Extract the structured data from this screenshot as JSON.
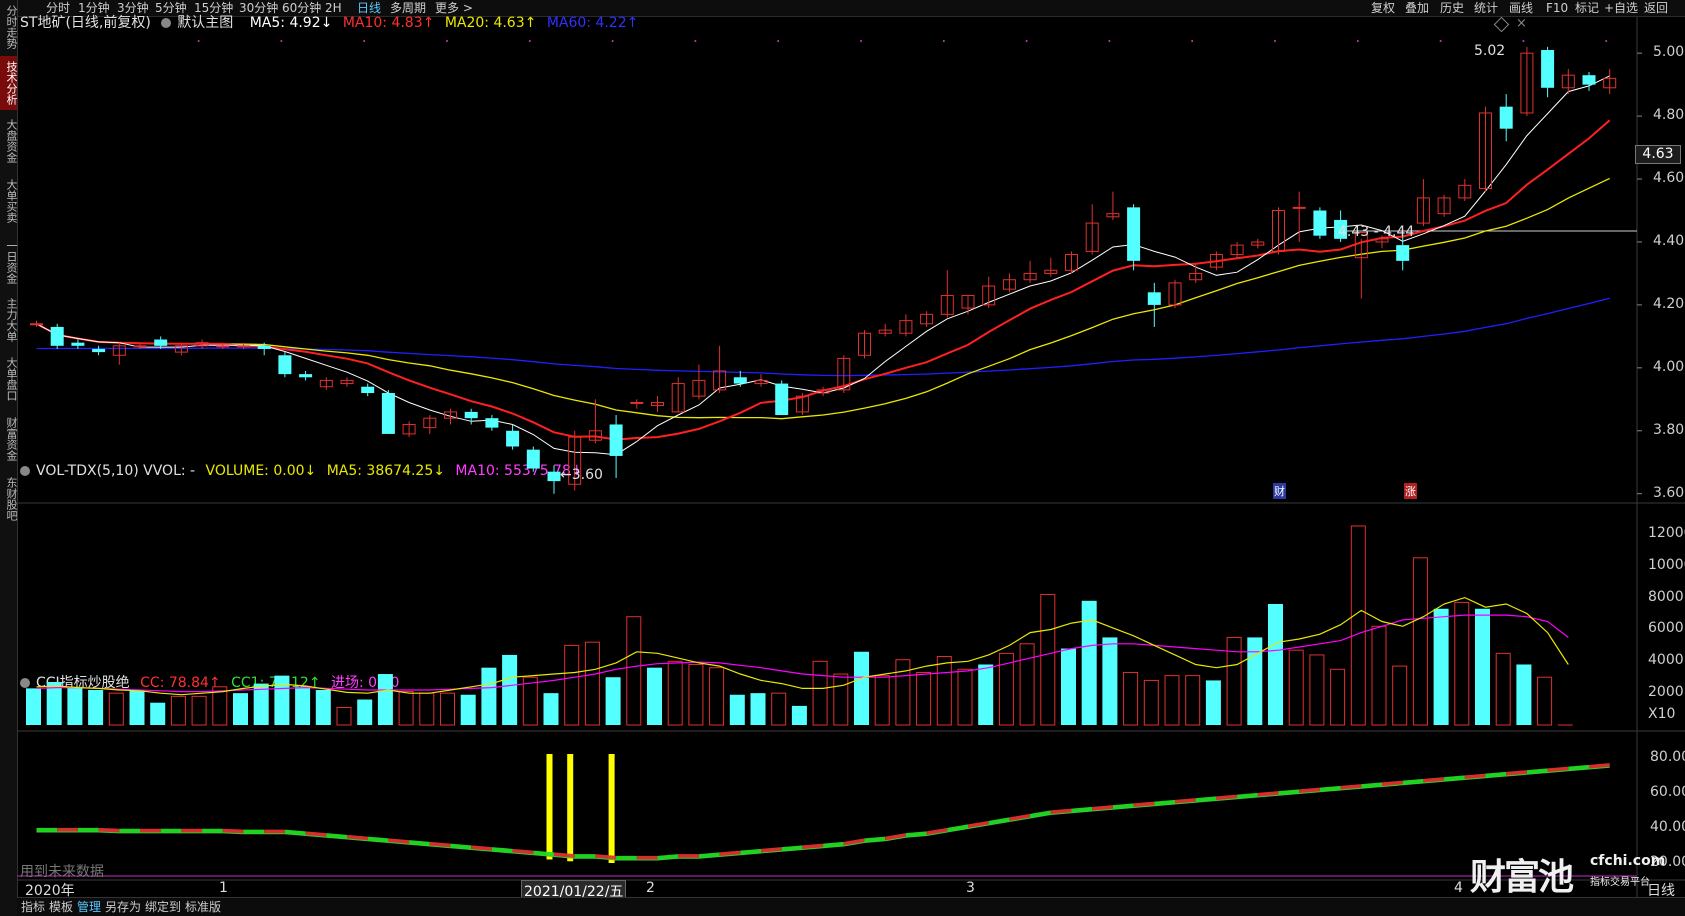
{
  "timeframes": [
    {
      "label": "分时",
      "active": false
    },
    {
      "label": "1分钟",
      "active": false
    },
    {
      "label": "3分钟",
      "active": false
    },
    {
      "label": "5分钟",
      "active": false
    },
    {
      "label": "15分钟",
      "active": false
    },
    {
      "label": "30分钟",
      "active": false
    },
    {
      "label": "60分钟",
      "active": false
    },
    {
      "label": "2H",
      "active": false
    },
    {
      "label": "日线",
      "active": true
    },
    {
      "label": "多周期",
      "active": false
    },
    {
      "label": "更多 >",
      "active": false
    }
  ],
  "right_toolbar": [
    "复权",
    "叠加",
    "历史",
    "统计",
    "画线",
    "F10",
    "标记",
    "+自选",
    "返回"
  ],
  "sidebar_tabs": [
    {
      "label": "分时走势",
      "active": false
    },
    {
      "label": "技术分析",
      "active": true
    },
    {
      "label": "大盘资金",
      "active": false
    },
    {
      "label": "大单买卖",
      "active": false
    },
    {
      "label": "一日资金",
      "active": false
    },
    {
      "label": "主力大单",
      "active": false
    },
    {
      "label": "大单盘口",
      "active": false
    },
    {
      "label": "财富资金",
      "active": false
    },
    {
      "label": "东财股吧",
      "active": false
    }
  ],
  "main_legend": {
    "stock": "ST地矿(日线,前复权)",
    "main_chart": "默认主图",
    "ma5": "MA5: 4.92↓",
    "ma10": "MA10: 4.83↑",
    "ma20": "MA20: 4.63↑",
    "ma60": "MA60: 4.22↑"
  },
  "vol_legend": {
    "title": "VOL-TDX(5,10) VVOL: -",
    "volume": "VOLUME: 0.00↓",
    "ma5": "MA5: 38674.25↓",
    "ma10": "MA10: 55375.78↓"
  },
  "cci_legend": {
    "title": "CCI指标炒股绝",
    "cc": "CC: 78.84↑",
    "cc1": "CC1: 75.12↑",
    "entry": "进场: 0.00"
  },
  "price_axis": [
    "5.00",
    "4.80",
    "4.60",
    "4.40",
    "4.20",
    "4.00",
    "3.80",
    "3.60"
  ],
  "current_price": "4.63",
  "vol_axis": [
    "12000",
    "10000",
    "8000",
    "6000",
    "4000",
    "2000"
  ],
  "vol_unit": "X10",
  "cci_axis": [
    "80.00",
    "60.00",
    "40.00",
    "20.00"
  ],
  "annotations": {
    "low": "←3.60",
    "high": "5.02",
    "range": "4.43 - 4.44",
    "event_cai": "财",
    "event_zhang": "涨",
    "future_data": "用到未来数据",
    "watermark_cn": "财富池",
    "watermark_url": "cfchi.com",
    "watermark_sub": "指标交易平台"
  },
  "time_axis": {
    "year": "2020年",
    "m1": "1",
    "cursor_date": "2021/01/22/五",
    "m2": "2",
    "m3": "3",
    "m4": "4",
    "period": "日线"
  },
  "bottom_tabs": [
    {
      "label": "指标",
      "active": false
    },
    {
      "label": "模板",
      "active": false
    },
    {
      "label": "管理",
      "active": true
    },
    {
      "label": "另存为",
      "active": false
    },
    {
      "label": "绑定到",
      "active": false
    },
    {
      "label": "标准版",
      "active": false
    }
  ],
  "colors": {
    "up": "#e0312f",
    "down": "#54ffff",
    "ma5": "#ffffff",
    "ma10": "#ff2020",
    "ma20": "#e8e800",
    "ma60": "#2020ff",
    "vol_ma5": "#e8e800",
    "vol_ma10": "#ff00ff",
    "cci_entry": "#ffff00"
  },
  "chart_data": {
    "type": "candlestick",
    "price_ylim": [
      3.58,
      5.08
    ],
    "candles": [
      [
        4.14,
        4.15,
        4.13,
        4.14
      ],
      [
        4.13,
        4.14,
        4.06,
        4.07
      ],
      [
        4.08,
        4.09,
        4.06,
        4.07
      ],
      [
        4.06,
        4.07,
        4.04,
        4.05
      ],
      [
        4.04,
        4.08,
        4.01,
        4.07
      ],
      [
        4.07,
        4.08,
        4.06,
        4.07
      ],
      [
        4.09,
        4.1,
        4.06,
        4.07
      ],
      [
        4.05,
        4.08,
        4.04,
        4.07
      ],
      [
        4.07,
        4.09,
        4.06,
        4.08
      ],
      [
        4.07,
        4.08,
        4.06,
        4.07
      ],
      [
        4.07,
        4.08,
        4.06,
        4.07
      ],
      [
        4.07,
        4.08,
        4.04,
        4.06
      ],
      [
        4.04,
        4.05,
        3.97,
        3.98
      ],
      [
        3.98,
        3.99,
        3.96,
        3.97
      ],
      [
        3.94,
        3.97,
        3.93,
        3.96
      ],
      [
        3.95,
        3.97,
        3.94,
        3.96
      ],
      [
        3.94,
        3.95,
        3.91,
        3.92
      ],
      [
        3.92,
        3.93,
        3.79,
        3.79
      ],
      [
        3.79,
        3.83,
        3.78,
        3.82
      ],
      [
        3.81,
        3.85,
        3.79,
        3.84
      ],
      [
        3.84,
        3.87,
        3.82,
        3.86
      ],
      [
        3.86,
        3.87,
        3.82,
        3.84
      ],
      [
        3.84,
        3.85,
        3.8,
        3.81
      ],
      [
        3.8,
        3.82,
        3.74,
        3.75
      ],
      [
        3.74,
        3.75,
        3.67,
        3.68
      ],
      [
        3.67,
        3.69,
        3.6,
        3.64
      ],
      [
        3.63,
        3.8,
        3.61,
        3.78
      ],
      [
        3.77,
        3.9,
        3.76,
        3.8
      ],
      [
        3.82,
        3.85,
        3.65,
        3.72
      ],
      [
        3.89,
        3.9,
        3.87,
        3.89
      ],
      [
        3.88,
        3.91,
        3.86,
        3.89
      ],
      [
        3.86,
        3.97,
        3.86,
        3.95
      ],
      [
        3.91,
        4.01,
        3.9,
        3.96
      ],
      [
        3.93,
        4.07,
        3.92,
        3.99
      ],
      [
        3.97,
        3.99,
        3.94,
        3.95
      ],
      [
        3.95,
        3.98,
        3.94,
        3.96
      ],
      [
        3.95,
        3.96,
        3.85,
        3.85
      ],
      [
        3.86,
        3.92,
        3.85,
        3.91
      ],
      [
        3.92,
        3.94,
        3.91,
        3.93
      ],
      [
        3.93,
        4.04,
        3.92,
        4.03
      ],
      [
        4.04,
        4.12,
        4.03,
        4.11
      ],
      [
        4.11,
        4.14,
        4.1,
        4.12
      ],
      [
        4.11,
        4.17,
        4.1,
        4.15
      ],
      [
        4.14,
        4.18,
        4.13,
        4.17
      ],
      [
        4.17,
        4.31,
        4.16,
        4.23
      ],
      [
        4.19,
        4.23,
        4.17,
        4.23
      ],
      [
        4.2,
        4.29,
        4.19,
        4.26
      ],
      [
        4.25,
        4.3,
        4.24,
        4.28
      ],
      [
        4.28,
        4.34,
        4.27,
        4.3
      ],
      [
        4.3,
        4.35,
        4.29,
        4.31
      ],
      [
        4.31,
        4.37,
        4.3,
        4.36
      ],
      [
        4.37,
        4.52,
        4.36,
        4.46
      ],
      [
        4.48,
        4.56,
        4.47,
        4.49
      ],
      [
        4.51,
        4.52,
        4.31,
        4.34
      ],
      [
        4.24,
        4.27,
        4.13,
        4.2
      ],
      [
        4.2,
        4.28,
        4.19,
        4.27
      ],
      [
        4.28,
        4.33,
        4.27,
        4.3
      ],
      [
        4.32,
        4.37,
        4.31,
        4.36
      ],
      [
        4.36,
        4.4,
        4.35,
        4.39
      ],
      [
        4.39,
        4.41,
        4.38,
        4.4
      ],
      [
        4.37,
        4.51,
        4.36,
        4.5
      ],
      [
        4.51,
        4.56,
        4.4,
        4.51
      ],
      [
        4.5,
        4.51,
        4.41,
        4.42
      ],
      [
        4.47,
        4.5,
        4.4,
        4.41
      ],
      [
        4.35,
        4.41,
        4.22,
        4.43
      ],
      [
        4.4,
        4.42,
        4.38,
        4.41
      ],
      [
        4.39,
        4.42,
        4.31,
        4.34
      ],
      [
        4.46,
        4.6,
        4.45,
        4.54
      ],
      [
        4.49,
        4.55,
        4.48,
        4.54
      ],
      [
        4.54,
        4.6,
        4.53,
        4.58
      ],
      [
        4.57,
        4.83,
        4.56,
        4.81
      ],
      [
        4.83,
        4.87,
        4.72,
        4.76
      ],
      [
        4.81,
        5.02,
        4.8,
        5.0
      ],
      [
        5.01,
        5.02,
        4.86,
        4.89
      ],
      [
        4.89,
        4.95,
        4.87,
        4.93
      ],
      [
        4.93,
        4.94,
        4.88,
        4.9
      ],
      [
        4.89,
        4.95,
        4.87,
        4.92
      ]
    ],
    "vol_ylim": [
      0,
      13000
    ],
    "volumes": [
      [
        2300,
        0
      ],
      [
        2700,
        0
      ],
      [
        2400,
        0
      ],
      [
        2200,
        0
      ],
      [
        2000,
        1
      ],
      [
        2200,
        0
      ],
      [
        1400,
        0
      ],
      [
        1800,
        1
      ],
      [
        1800,
        1
      ],
      [
        2400,
        1
      ],
      [
        2000,
        0
      ],
      [
        2600,
        0
      ],
      [
        3100,
        0
      ],
      [
        2400,
        0
      ],
      [
        2200,
        0
      ],
      [
        1100,
        1
      ],
      [
        1600,
        0
      ],
      [
        3200,
        0
      ],
      [
        2100,
        1
      ],
      [
        2000,
        1
      ],
      [
        2000,
        1
      ],
      [
        1900,
        0
      ],
      [
        3600,
        0
      ],
      [
        4400,
        0
      ],
      [
        3000,
        1
      ],
      [
        2000,
        0
      ],
      [
        5000,
        1
      ],
      [
        5200,
        1
      ],
      [
        3000,
        0
      ],
      [
        6800,
        1
      ],
      [
        3600,
        0
      ],
      [
        4000,
        1
      ],
      [
        3800,
        1
      ],
      [
        3600,
        1
      ],
      [
        1900,
        0
      ],
      [
        2000,
        0
      ],
      [
        2000,
        1
      ],
      [
        1200,
        0
      ],
      [
        4000,
        1
      ],
      [
        3200,
        1
      ],
      [
        4600,
        0
      ],
      [
        3100,
        1
      ],
      [
        4100,
        1
      ],
      [
        3300,
        1
      ],
      [
        4300,
        1
      ],
      [
        3500,
        1
      ],
      [
        3800,
        0
      ],
      [
        4500,
        1
      ],
      [
        5100,
        1
      ],
      [
        8200,
        1
      ],
      [
        4800,
        0
      ],
      [
        7800,
        0
      ],
      [
        5500,
        0
      ],
      [
        3300,
        1
      ],
      [
        2800,
        1
      ],
      [
        3100,
        1
      ],
      [
        3100,
        1
      ],
      [
        2800,
        0
      ],
      [
        5500,
        1
      ],
      [
        5500,
        0
      ],
      [
        7600,
        0
      ],
      [
        4700,
        1
      ],
      [
        4400,
        1
      ],
      [
        3500,
        1
      ],
      [
        12500,
        1
      ],
      [
        6200,
        1
      ],
      [
        3700,
        1
      ],
      [
        10500,
        1
      ],
      [
        7300,
        0
      ],
      [
        7700,
        1
      ],
      [
        7300,
        0
      ],
      [
        4500,
        1
      ],
      [
        3800,
        0
      ],
      [
        3000,
        1
      ],
      [
        0,
        1
      ]
    ],
    "vol_ma5": [
      2400,
      2450,
      2350,
      2300,
      2200,
      2150,
      2000,
      1900,
      2000,
      2100,
      2300,
      2450,
      2550,
      2450,
      2250,
      2050,
      2000,
      2200,
      2000,
      2000,
      2200,
      2400,
      2600,
      3000,
      3100,
      3200,
      3300,
      3500,
      3900,
      4600,
      4500,
      4200,
      3900,
      3700,
      3200,
      2800,
      2600,
      2300,
      2300,
      2500,
      3000,
      3200,
      3400,
      3700,
      3900,
      4000,
      4400,
      5000,
      5800,
      6000,
      6400,
      6600,
      6100,
      5600,
      5000,
      4400,
      3800,
      3600,
      3800,
      4500,
      5200,
      5400,
      5700,
      6300,
      7200,
      6500,
      6200,
      6800,
      7600,
      8000,
      7400,
      7600,
      7000,
      5800,
      3800
    ],
    "vol_ma10": [
      2300,
      2350,
      2350,
      2300,
      2250,
      2200,
      2150,
      2100,
      2100,
      2150,
      2200,
      2250,
      2300,
      2350,
      2300,
      2250,
      2200,
      2200,
      2200,
      2200,
      2250,
      2300,
      2350,
      2500,
      2650,
      2800,
      3000,
      3200,
      3500,
      3700,
      3850,
      3900,
      3950,
      3900,
      3750,
      3600,
      3400,
      3200,
      3100,
      3000,
      3000,
      3000,
      3100,
      3200,
      3300,
      3400,
      3600,
      3900,
      4200,
      4500,
      4800,
      5000,
      5100,
      5100,
      5000,
      4900,
      4800,
      4700,
      4600,
      4600,
      4700,
      4900,
      5100,
      5300,
      5800,
      6200,
      6600,
      6700,
      6800,
      6900,
      6900,
      6900,
      6800,
      6500,
      5500
    ],
    "cci_ylim": [
      10,
      90
    ],
    "cci_values": [
      38,
      38,
      38,
      38,
      37.5,
      37.5,
      37.5,
      37.5,
      37.5,
      37.5,
      37,
      37,
      37,
      36,
      35,
      34,
      33,
      32,
      31,
      30,
      29,
      28,
      27,
      26,
      25,
      24,
      23,
      23,
      22,
      22,
      22,
      23,
      23,
      24,
      25,
      26,
      27,
      28,
      29,
      30,
      32,
      33,
      35,
      36,
      38,
      40,
      42,
      44,
      46,
      48,
      49,
      50,
      51,
      52,
      53,
      54,
      55,
      56,
      57,
      58,
      59,
      60,
      61,
      62,
      63,
      64,
      65,
      66,
      67,
      68,
      69,
      70,
      71,
      72,
      73,
      74,
      75
    ],
    "cci_entries": [
      25,
      26,
      28
    ]
  }
}
